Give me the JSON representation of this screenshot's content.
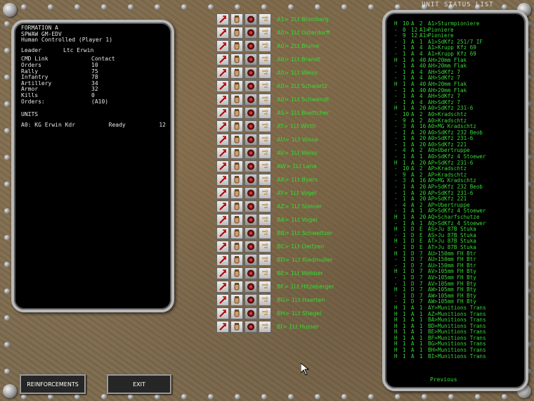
{
  "left_panel": {
    "title": "FORMATION A",
    "subtitle": "SPWAW GM-EDV",
    "control": "Human Controlled (Player 1)",
    "leader_label": "Leader",
    "leader_value": "Ltc Erwin",
    "cmd_link_label": "CMD Link",
    "contact_label": "Contact",
    "stats": [
      {
        "label": "Orders",
        "value": "10"
      },
      {
        "label": "Rally",
        "value": "75"
      },
      {
        "label": "Infantry",
        "value": "78"
      },
      {
        "label": "Artillery",
        "value": "34"
      },
      {
        "label": "Armor",
        "value": "32"
      },
      {
        "label": "Kills",
        "value": "0"
      },
      {
        "label": "Orders:",
        "value": "(A10)"
      }
    ],
    "units_header": "UNITS",
    "unit_row": {
      "id": "A0: KG Erwin Kdr",
      "state": "Ready",
      "num": "12"
    }
  },
  "formation_list": [
    "A1> 2Lt Blumberg",
    "A0> 1Lt Osterdorff",
    "A0> 2Lt Blume",
    "A0> 1Lt Brandt",
    "A0> 1Lt Weiss",
    "A0> 2Lt Schwartz",
    "A0> 1Lt Schwendt",
    "AS> 1Lt Boettcher",
    "AT> 1Lt Wirth",
    "AU> 1Lt Vosse",
    "AV> 1Lt Weiss",
    "AW> 1Lt Lane",
    "AX> 1Lt Byers",
    "AY> 1Lt Vogel",
    "AZ> 1Lt Steiner",
    "BA> 1Lt Vogel",
    "BB> 1Lt Schweitzer",
    "BC> 1Lt Oertzen",
    "BD> 1Lt Riedmuller",
    "BE> 1Lt Webber",
    "BF> 1Lt Hitzeberger",
    "BG> 1Lt Haerten",
    "BH> 1Lt Stiegel",
    "BI> 1Lt Husser"
  ],
  "status_panel": {
    "title": "UNIT STATUS LIST",
    "rows": [
      [
        "H",
        "10",
        "A",
        "2",
        "A1>",
        "Sturmpioniere"
      ],
      [
        "-",
        "0",
        "12",
        "A1>",
        "Pioniere",
        ""
      ],
      [
        "-",
        "9",
        "12",
        "A1>",
        "Pioniere",
        ""
      ],
      [
        "-",
        "1",
        "A",
        "1",
        "A1>",
        "SdKfz 251/7 IF"
      ],
      [
        "-",
        "1",
        "A",
        "4",
        "A1>",
        "Krupp Kfz 69"
      ],
      [
        "-",
        "1",
        "A",
        "4",
        "A1>",
        "Krupp Kfz 69"
      ],
      [
        "H",
        "1",
        "A",
        "40",
        "AH>",
        "20mm Flak"
      ],
      [
        "-",
        "1",
        "A",
        "40",
        "AH>",
        "20mm Flak"
      ],
      [
        "-",
        "1",
        "A",
        "4",
        "AH>",
        "SdKfz 7"
      ],
      [
        "-",
        "1",
        "A",
        "4",
        "AH>",
        "SdKfz 7"
      ],
      [
        "H",
        "1",
        "A",
        "40",
        "AH>",
        "20mm Flak"
      ],
      [
        "-",
        "1",
        "A",
        "40",
        "AH>",
        "20mm Flak"
      ],
      [
        "-",
        "1",
        "A",
        "4",
        "AH>",
        "SdKfz 7"
      ],
      [
        "-",
        "1",
        "A",
        "4",
        "AH>",
        "SdKfz 7"
      ],
      [
        "H",
        "1",
        "A",
        "20",
        "A0>",
        "SdKfz 231-6"
      ],
      [
        "-",
        "10",
        "A",
        "2",
        "A0>",
        "Kradschtz"
      ],
      [
        "-",
        "9",
        "A",
        "2",
        "A0>",
        "Kradschtz"
      ],
      [
        "-",
        "3",
        "A",
        "16",
        "A0>",
        "MG Kradschtz"
      ],
      [
        "-",
        "1",
        "A",
        "20",
        "A0>",
        "SdKfz 232 Beob"
      ],
      [
        "-",
        "1",
        "A",
        "20",
        "A0>",
        "SdKfz 231-6"
      ],
      [
        "-",
        "1",
        "A",
        "20",
        "A0>",
        "SdKfz 221"
      ],
      [
        "-",
        "4",
        "A",
        "2",
        "A0>",
        "Ubertruppe"
      ],
      [
        "-",
        "1",
        "A",
        "1",
        "A0>",
        "SdKfz 4 Stoewer"
      ],
      [
        "H",
        "1",
        "A",
        "20",
        "AP>",
        "SdKfz 231-6"
      ],
      [
        "-",
        "10",
        "A",
        "2",
        "AP>",
        "Kradschtz"
      ],
      [
        "-",
        "9",
        "A",
        "2",
        "AP>",
        "Kradschtz"
      ],
      [
        "-",
        "3",
        "A",
        "16",
        "AP>",
        "MG Kradschtz"
      ],
      [
        "-",
        "1",
        "A",
        "20",
        "AP>",
        "SdKfz 232 Beob"
      ],
      [
        "-",
        "1",
        "A",
        "20",
        "AP>",
        "SdKfz 231-6"
      ],
      [
        "-",
        "1",
        "A",
        "20",
        "AP>",
        "SdKfz 221"
      ],
      [
        "-",
        "4",
        "A",
        "2",
        "AP>",
        "Ubertruppe"
      ],
      [
        "-",
        "1",
        "A",
        "1",
        "AP>",
        "SdKfz 4 Stoewer"
      ],
      [
        "H",
        "1",
        "A",
        "20",
        "AQ>",
        "Scharfschutze"
      ],
      [
        "-",
        "1",
        "A",
        "1",
        "AQ>",
        "SdKfz 4 Stoewer"
      ],
      [
        "H",
        "1",
        "D",
        "E",
        "AS>",
        "Ju 87B Stuka"
      ],
      [
        "-",
        "1",
        "D",
        "E",
        "AS>",
        "Ju 87B Stuka"
      ],
      [
        "H",
        "1",
        "D",
        "E",
        "AT>",
        "Ju 87B Stuka"
      ],
      [
        "-",
        "1",
        "D",
        "E",
        "AT>",
        "Ju 87B Stuka"
      ],
      [
        "H",
        "1",
        "D",
        "7",
        "AU>",
        "150mm FH Btr"
      ],
      [
        "-",
        "1",
        "D",
        "7",
        "AU>",
        "150mm FH Btr"
      ],
      [
        "-",
        "1",
        "D",
        "7",
        "AU>",
        "150mm FH Btr"
      ],
      [
        "H",
        "1",
        "D",
        "7",
        "AV>",
        "105mm FH Bty"
      ],
      [
        "-",
        "1",
        "D",
        "7",
        "AV>",
        "105mm FH Bty"
      ],
      [
        "-",
        "1",
        "D",
        "7",
        "AV>",
        "105mm FH Bty"
      ],
      [
        "H",
        "1",
        "D",
        "7",
        "AW>",
        "105mm FH Bty"
      ],
      [
        "-",
        "1",
        "D",
        "7",
        "AW>",
        "105mm FH Bty"
      ],
      [
        "-",
        "1",
        "D",
        "7",
        "AW>",
        "105mm FH Bty"
      ],
      [
        "H",
        "1",
        "A",
        "1",
        "AY>",
        "Munitions Trans"
      ],
      [
        "H",
        "1",
        "A",
        "1",
        "AZ>",
        "Munitions Trans"
      ],
      [
        "H",
        "1",
        "A",
        "1",
        "BA>",
        "Munitions Trans"
      ],
      [
        "H",
        "1",
        "A",
        "1",
        "BD>",
        "Munitions Trans"
      ],
      [
        "H",
        "1",
        "A",
        "1",
        "BE>",
        "Munitions Trans"
      ],
      [
        "H",
        "1",
        "A",
        "1",
        "BF>",
        "Munitions Trans"
      ],
      [
        "H",
        "1",
        "A",
        "1",
        "BG>",
        "Munitions Trans"
      ],
      [
        "H",
        "1",
        "A",
        "1",
        "BH>",
        "Munitions Trans"
      ],
      [
        "H",
        "1",
        "A",
        "1",
        "BI>",
        "Munitions Trans"
      ]
    ],
    "previous_label": "Previous"
  },
  "buttons": {
    "reinforcements": "REINFORCEMENTS",
    "exit": "EXIT"
  },
  "colors": {
    "green_text": "#38d638",
    "panel_border": "#b9b9b9"
  }
}
